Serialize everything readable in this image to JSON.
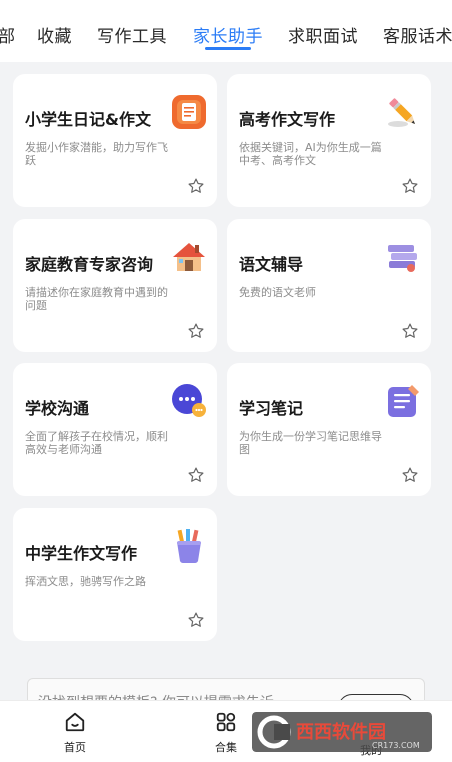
{
  "tabs": [
    {
      "label": "部"
    },
    {
      "label": "收藏"
    },
    {
      "label": "写作工具"
    },
    {
      "label": "家长助手"
    },
    {
      "label": "求职面试"
    },
    {
      "label": "客服话术"
    }
  ],
  "active_tab": "家长助手",
  "cards": [
    {
      "title": "小学生日记&作文",
      "desc": "发掘小作家潜能，助力写作飞跃",
      "icon": "document-icon"
    },
    {
      "title": "高考作文写作",
      "desc": "依据关键词，AI为你生成一篇中考、高考作文",
      "icon": "pencil-icon"
    },
    {
      "title": "家庭教育专家咨询",
      "desc": "请描述你在家庭教育中遇到的问题",
      "icon": "house-icon"
    },
    {
      "title": "语文辅导",
      "desc": "免费的语文老师",
      "icon": "books-icon"
    },
    {
      "title": "学校沟通",
      "desc": "全面了解孩子在校情况，顺利高效与老师沟通",
      "icon": "chat-bubble-icon"
    },
    {
      "title": "学习笔记",
      "desc": "为你生成一份学习笔记思维导图",
      "icon": "notepad-icon"
    },
    {
      "title": "中学生作文写作",
      "desc": "挥洒文思，驰骋写作之路",
      "icon": "pencil-cup-icon"
    }
  ],
  "banner": {
    "text": "没找到想要的模板? 你可以提需求告诉"
  },
  "bottom_nav": [
    {
      "label": "首页",
      "icon": "home-icon"
    },
    {
      "label": "合集",
      "icon": "grid-icon"
    },
    {
      "label": "我的",
      "icon": "user-icon"
    }
  ],
  "watermark": {
    "text": "西西软件园",
    "url": "CR173.COM"
  },
  "colors": {
    "accent": "#2b7cf6",
    "background": "#f2f3f5",
    "card": "#ffffff"
  }
}
